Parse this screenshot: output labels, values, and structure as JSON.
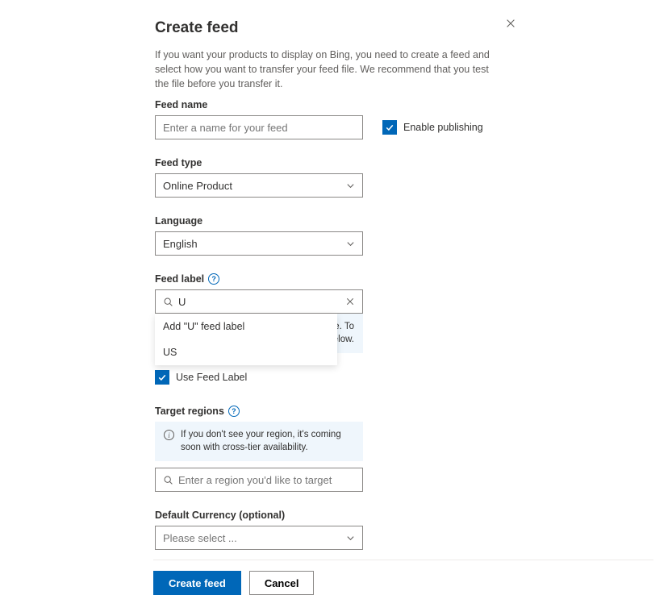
{
  "title": "Create feed",
  "description": "If you want your products to display on Bing, you need to create a feed and select how you want to transfer your feed file. We recommend that you test the file before you transfer it.",
  "feedName": {
    "label": "Feed name",
    "placeholder": "Enter a name for your feed",
    "value": ""
  },
  "enablePublishing": {
    "label": "Enable publishing",
    "checked": true
  },
  "feedType": {
    "label": "Feed type",
    "value": "Online Product"
  },
  "language": {
    "label": "Language",
    "value": "English"
  },
  "feedLabel": {
    "label": "Feed label",
    "value": "U",
    "dropdown": {
      "addItem": "Add \"U\" feed label",
      "match": "US"
    },
    "hiddenBannerTail": "e. To\nelow."
  },
  "useFeedLabel": {
    "label": "Use Feed Label",
    "checked": true
  },
  "targetRegions": {
    "label": "Target regions",
    "infoText": "If you don't see your region, it's coming soon with cross-tier availability.",
    "placeholder": "Enter a region you'd like to target"
  },
  "defaultCurrency": {
    "label": "Default Currency (optional)",
    "placeholder": "Please select ..."
  },
  "buttons": {
    "primary": "Create feed",
    "secondary": "Cancel"
  }
}
